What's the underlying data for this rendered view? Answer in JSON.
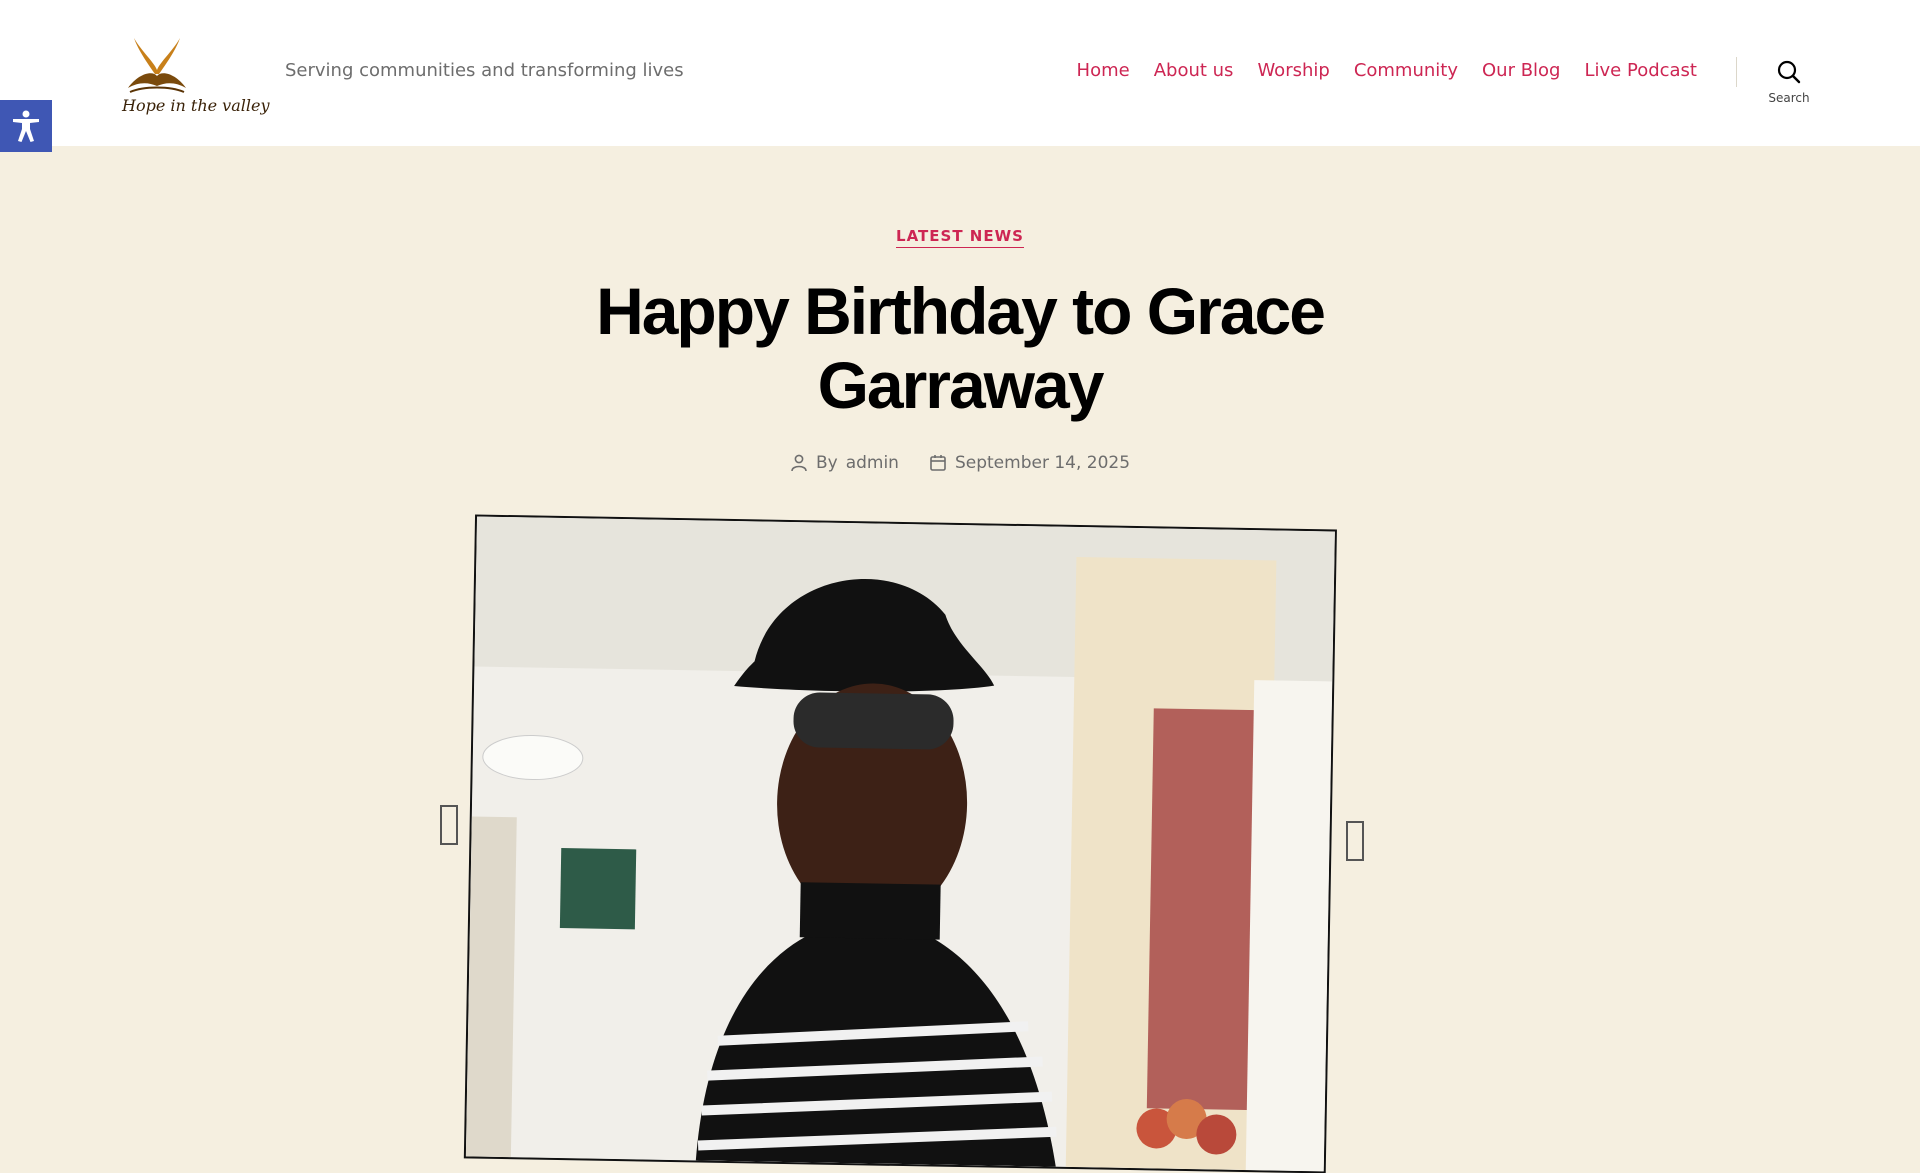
{
  "site": {
    "logo_text": "Hope in the valley",
    "tagline": "Serving communities and transforming lives"
  },
  "nav": {
    "items": [
      {
        "label": "Home"
      },
      {
        "label": "About us"
      },
      {
        "label": "Worship"
      },
      {
        "label": "Community"
      },
      {
        "label": "Our Blog"
      },
      {
        "label": "Live Podcast"
      }
    ]
  },
  "search": {
    "label": "Search",
    "icon": "search-icon"
  },
  "accessibility": {
    "icon": "accessibility-icon",
    "color": "#3f57b4"
  },
  "post": {
    "category": "LATEST NEWS",
    "title": "Happy Birthday to Grace Garraway",
    "author_prefix": "By",
    "author": "admin",
    "date": "September 14, 2025"
  },
  "colors": {
    "accent": "#cd2653",
    "background": "#f5efe0",
    "header": "#ffffff"
  }
}
